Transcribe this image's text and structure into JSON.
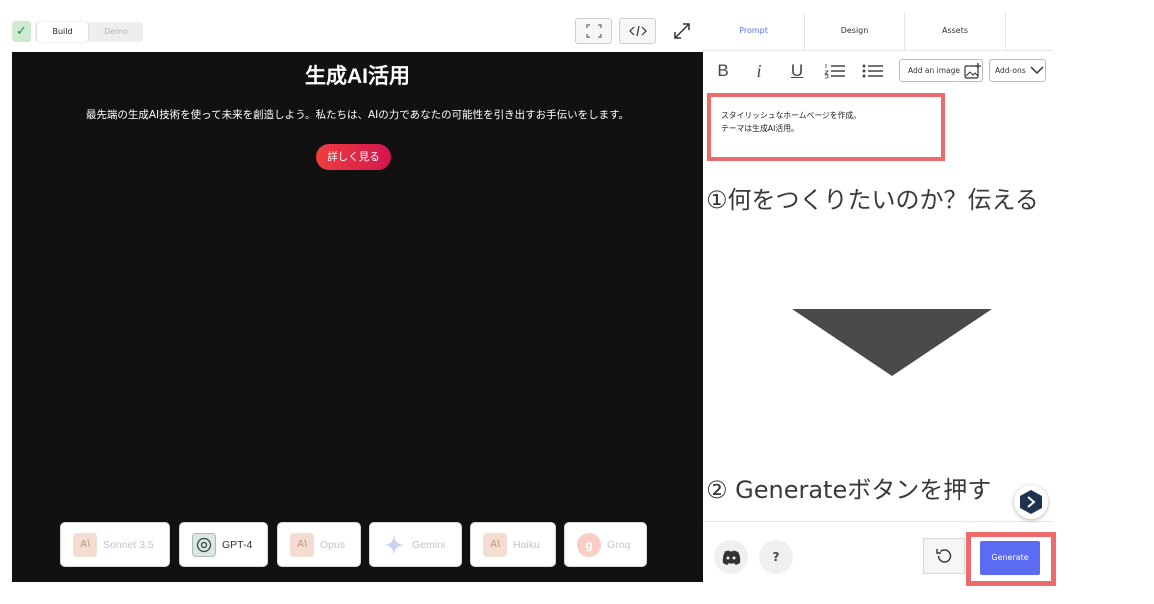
{
  "toolbar": {
    "modes": {
      "build": "Build",
      "demo": "Demo"
    }
  },
  "preview": {
    "title": "生成AI活用",
    "subtitle": "最先端の生成AI技術を使って未来を創造しよう。私たちは、AIの力であなたの可能性を引き出すお手伝いをします。",
    "cta": "詳しく見る"
  },
  "models": [
    {
      "label": "Sonnet 3.5",
      "icon": "anthropic-icon",
      "active": false
    },
    {
      "label": "GPT-4",
      "icon": "openai-icon",
      "active": true
    },
    {
      "label": "Opus",
      "icon": "anthropic-icon",
      "active": false
    },
    {
      "label": "Gemini",
      "icon": "gemini-icon",
      "active": false
    },
    {
      "label": "Haiku",
      "icon": "anthropic-icon",
      "active": false
    },
    {
      "label": "Groq",
      "icon": "groq-icon",
      "active": false
    }
  ],
  "panel": {
    "tabs": {
      "prompt": "Prompt",
      "design": "Design",
      "assets": "Assets"
    },
    "format": {
      "bold": "B",
      "italic": "i",
      "underline": "U"
    },
    "add_image": "Add an image",
    "addons": "Add-ons",
    "prompt_lines": [
      "スタイリッシュなホームページを作成。",
      "テーマは生成AI活用。"
    ],
    "help": "?",
    "generate": "Generate"
  },
  "annotations": {
    "step1": "①何をつくりたいのか？伝える",
    "step2": "② Generateボタンを押す"
  },
  "colors": {
    "accent": "#5c6cf2",
    "highlight": "#ef6b6b",
    "cta_gradient": [
      "#ef3e3e",
      "#d3164f"
    ],
    "preview_bg": "#111111"
  }
}
